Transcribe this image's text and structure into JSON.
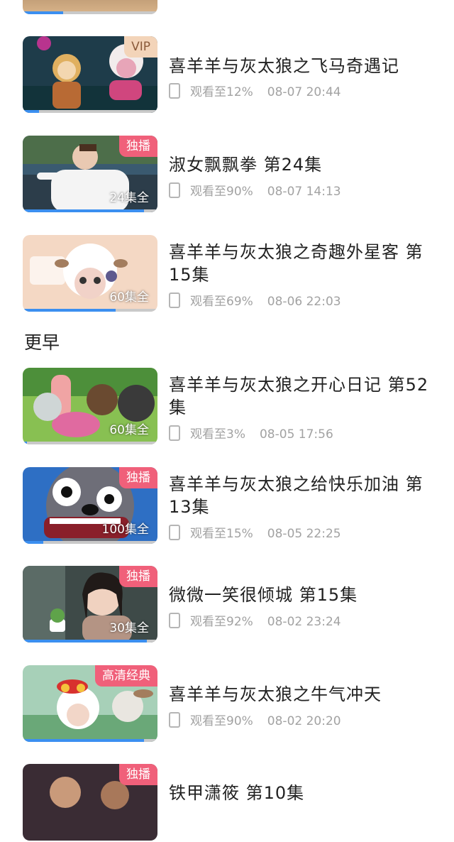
{
  "section_earlier": "更早",
  "items": [
    {
      "title": "",
      "progress": "",
      "date": "",
      "fill": 0.3
    },
    {
      "title": "喜羊羊与灰太狼之飞马奇遇记",
      "progress": "观看至12%",
      "date": "08-07 20:44",
      "badge": "VIP",
      "fill": 0.12
    },
    {
      "title": "淑女飘飘拳 第24集",
      "progress": "观看至90%",
      "date": "08-07 14:13",
      "badge": "独播",
      "count": "24集全",
      "fill": 0.9
    },
    {
      "title": "喜羊羊与灰太狼之奇趣外星客 第15集",
      "progress": "观看至69%",
      "date": "08-06 22:03",
      "count": "60集全",
      "fill": 0.69
    },
    {
      "title": "喜羊羊与灰太狼之开心日记 第52集",
      "progress": "观看至3%",
      "date": "08-05 17:56",
      "count": "60集全",
      "fill": 0.03
    },
    {
      "title": "喜羊羊与灰太狼之给快乐加油 第13集",
      "progress": "观看至15%",
      "date": "08-05 22:25",
      "badge": "独播",
      "count": "100集全",
      "fill": 0.15
    },
    {
      "title": "微微一笑很倾城 第15集",
      "progress": "观看至92%",
      "date": "08-02 23:24",
      "badge": "独播",
      "count": "30集全",
      "fill": 0.92
    },
    {
      "title": "喜羊羊与灰太狼之牛气冲天",
      "progress": "观看至90%",
      "date": "08-02 20:20",
      "badge": "高清经典",
      "fill": 0.9
    },
    {
      "title": "铁甲潇筱 第10集",
      "badge": "独播"
    }
  ]
}
